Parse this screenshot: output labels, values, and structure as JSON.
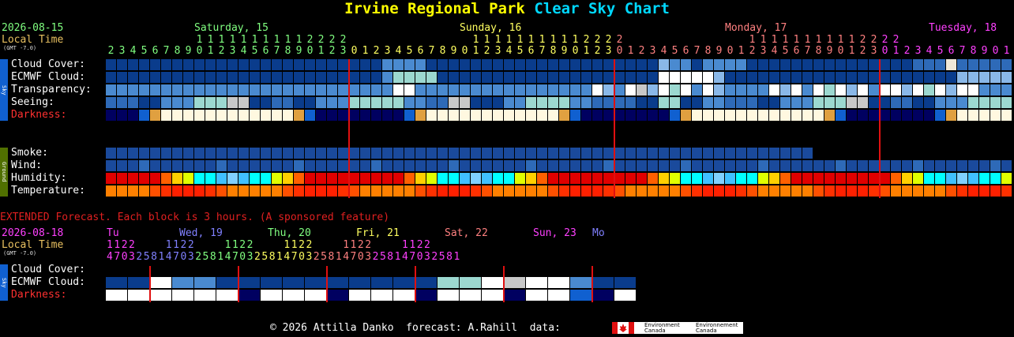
{
  "header": {
    "title_main": "Irvine Regional Park",
    "title_sub": "Clear Sky Chart"
  },
  "top": {
    "date": "2026-08-15",
    "local_time": "Local Time",
    "gmt": "(GMT -7.0)",
    "days": [
      {
        "label": "Saturday, 15",
        "color": "#80ff80"
      },
      {
        "label": "Sunday, 16",
        "color": "#ffff60"
      },
      {
        "label": "Monday, 17",
        "color": "#ff8080"
      },
      {
        "label": "Tuesday, 18",
        "color": "#ff40ff"
      }
    ],
    "hour_tens": [
      "",
      "",
      "",
      "",
      "",
      "",
      "",
      "",
      "1",
      "1",
      "1",
      "1",
      "1",
      "1",
      "1",
      "1",
      "1",
      "1",
      "2",
      "2",
      "2",
      "2",
      "",
      "",
      "",
      "",
      "",
      "",
      "",
      "",
      "",
      "",
      "",
      "1",
      "1",
      "1",
      "1",
      "1",
      "1",
      "1",
      "1",
      "1",
      "1",
      "2",
      "2",
      "2",
      "2",
      "",
      "",
      "",
      "",
      "",
      "",
      "",
      "",
      "",
      "",
      "",
      "1",
      "1",
      "1",
      "1",
      "1",
      "1",
      "1",
      "1",
      "1",
      "1",
      "2",
      "2",
      "2",
      "2",
      "",
      "",
      "",
      "",
      "",
      "",
      "",
      "",
      "",
      "",
      "",
      "1",
      "1"
    ],
    "hour_ones": [
      "2",
      "3",
      "4",
      "5",
      "6",
      "7",
      "8",
      "9",
      "0",
      "1",
      "2",
      "3",
      "4",
      "5",
      "6",
      "7",
      "8",
      "9",
      "0",
      "1",
      "2",
      "3",
      "0",
      "1",
      "2",
      "3",
      "4",
      "5",
      "6",
      "7",
      "8",
      "9",
      "0",
      "1",
      "2",
      "3",
      "4",
      "5",
      "6",
      "7",
      "8",
      "9",
      "0",
      "1",
      "2",
      "3",
      "0",
      "1",
      "2",
      "3",
      "4",
      "5",
      "6",
      "7",
      "8",
      "9",
      "0",
      "1",
      "2",
      "3",
      "4",
      "5",
      "6",
      "7",
      "8",
      "9",
      "0",
      "1",
      "2",
      "3",
      "0",
      "1",
      "2",
      "3",
      "4",
      "5",
      "6",
      "7",
      "8",
      "9",
      "0",
      "1"
    ],
    "rows": [
      {
        "label": "Cloud Cover:",
        "colors": [
          "#0a3c8c",
          "#0a3c8c",
          "#0a3c8c",
          "#0a3c8c",
          "#0a3c8c",
          "#0a3c8c",
          "#0a3c8c",
          "#0a3c8c",
          "#0a3c8c",
          "#0a3c8c",
          "#0a3c8c",
          "#0a3c8c",
          "#0a3c8c",
          "#0a3c8c",
          "#0a3c8c",
          "#0a3c8c",
          "#0a3c8c",
          "#0a3c8c",
          "#0a3c8c",
          "#0a3c8c",
          "#0a3c8c",
          "#0a3c8c",
          "#0a3c8c",
          "#0a3c8c",
          "#0a3c8c",
          "#2e6ab8",
          "#4a8ad0",
          "#4a8ad0",
          "#2e6ab8",
          "#2e6ab8",
          "#0a3c8c",
          "#0a3c8c",
          "#0a3c8c",
          "#0a3c8c",
          "#0a3c8c",
          "#0a3c8c",
          "#0a3c8c",
          "#0a3c8c",
          "#0a3c8c",
          "#0a3c8c",
          "#0a3c8c",
          "#0a3c8c",
          "#0a3c8c",
          "#0a3c8c",
          "#0a3c8c",
          "#0a3c8c",
          "#2e6ab8",
          "#4a8ad0",
          "#4a8ad0",
          "#2e6ab8",
          "#0a3c8c",
          "#4a8ad0",
          "#4a8ad0",
          "#2e6ab8",
          "#0a3c8c",
          "#0a3c8c",
          "#0a3c8c",
          "#0a3c8c",
          "#0a3c8c",
          "#0a3c8c",
          "#0a3c8c",
          "#0a3c8c",
          "#4a8ad0",
          "#4a8ad0",
          "#0a3c8c",
          "#0a3c8c",
          "#0a3c8c",
          "#0a3c8c",
          "#4a8ad0",
          "#0a3c8c",
          "#0a3c8c",
          "#0a3c8c",
          "#0a3c8c",
          "#0a3c8c",
          "#0a3c8c",
          "#0a3c8c",
          "#0a3c8c",
          "#0a3c8c",
          "#0a3c8c",
          "#0a3c8c",
          "#0a3c8c",
          "#0a3c8c",
          "#2e6ab8",
          "#2e6ab8",
          "#2e6ab8",
          "#2e6ab8",
          "#2e6ab8",
          "#2e6ab8",
          "#2e6ab8",
          "#2e6ab8",
          "#2e6ab8",
          "#2e6ab8",
          "#2e6ab8",
          "#2e6ab8",
          "#2e6ab8",
          "#2e6ab8",
          "#2e6ab8",
          "#2e6ab8",
          "#2e6ab8",
          "#2e6ab8",
          "#2e6ab8",
          "#2e6ab8",
          "#2e6ab8",
          "#2e6ab8",
          "#0a3c8c",
          "#0a3c8c",
          "#0a3c8c",
          "#0a3c8c",
          "#0a3c8c",
          "#0a3c8c",
          "#0a3c8c",
          "#4a8ad0",
          "#4a8ad0",
          "#4a8ad0",
          "#4a8ad0",
          "#2e6ab8",
          "#2e6ab8",
          "#2e6ab8",
          "#2e6ab8",
          "#2e6ab8",
          "#2e6ab8",
          "#2e6ab8",
          "#2e6ab8",
          "#2e6ab8",
          "#2e6ab8",
          "#2e6ab8",
          "#2e6ab8",
          "#2e6ab8",
          "#2e6ab8",
          "#4a8ad0",
          "#4a8ad0",
          "#e8e8e8",
          "#4a8ad0",
          "#2e6ab8",
          "#2e6ab8",
          "#2e6ab8",
          "#2e6ab8",
          "#2e6ab8",
          "#2e6ab8",
          "#2e6ab8",
          "#2e6ab8",
          "#2e6ab8",
          "#2e6ab8",
          "#2e6ab8",
          "#2e6ab8",
          "#2e6ab8",
          "#2e6ab8",
          "#2e6ab8",
          "#2e6ab8",
          "#2e6ab8",
          "#2e6ab8",
          "#2e6ab8",
          "#2e6ab8",
          "#2e6ab8",
          "#e8e8e8",
          "#2e6ab8",
          "#2e6ab8",
          "#2e6ab8",
          "#2e6ab8",
          "#2e6ab8",
          "#2e6ab8",
          "#2e6ab8",
          "#2e6ab8",
          "#2e6ab8",
          "#2e6ab8",
          "#2e6ab8",
          "#2e6ab8",
          "#2e6ab8",
          "#2e6ab8",
          "#2e6ab8",
          "#2e6ab8",
          "#2e6ab8",
          "#2e6ab8",
          "#2e6ab8",
          "#2e6ab8",
          "#2e6ab8",
          "#2e6ab8"
        ]
      },
      {
        "label": "ECMWF Cloud:",
        "colors": []
      },
      {
        "label": "Transparency:",
        "colors": []
      },
      {
        "label": "Seeing:",
        "colors": []
      },
      {
        "label": "Darkness:",
        "colors": []
      }
    ],
    "rows2": [
      {
        "label": "Smoke:"
      },
      {
        "label": "Wind:"
      },
      {
        "label": "Humidity:"
      },
      {
        "label": "Temperature:"
      }
    ],
    "sky_tab": "Sky",
    "ground_tab": "Ground"
  },
  "extended": {
    "notice": "EXTENDED Forecast. Each block is 3 hours. (A sponsored feature)",
    "date": "2026-08-18",
    "local_time": "Local Time",
    "gmt": "(GMT -7.0)",
    "days": [
      {
        "label": "Tu",
        "color": "#ff40ff"
      },
      {
        "label": "Wed, 19",
        "color": "#8080ff"
      },
      {
        "label": "Thu, 20",
        "color": "#80ff80"
      },
      {
        "label": "Fri, 21",
        "color": "#ffff60"
      },
      {
        "label": "Sat, 22",
        "color": "#ff8080"
      },
      {
        "label": "Sun, 23",
        "color": "#ff40ff"
      },
      {
        "label": "Mo",
        "color": "#8080ff"
      }
    ],
    "rows": [
      {
        "label": "Cloud Cover:"
      },
      {
        "label": "ECMWF Cloud:"
      },
      {
        "label": "Darkness:"
      }
    ],
    "sky_tab": "Sky"
  },
  "footer": {
    "credit": "© 2026 Attilla Danko  forecast: A.Rahill  data:",
    "env1": "Environment",
    "env1b": "Canada",
    "env2": "Environnement",
    "env2b": "Canada"
  }
}
